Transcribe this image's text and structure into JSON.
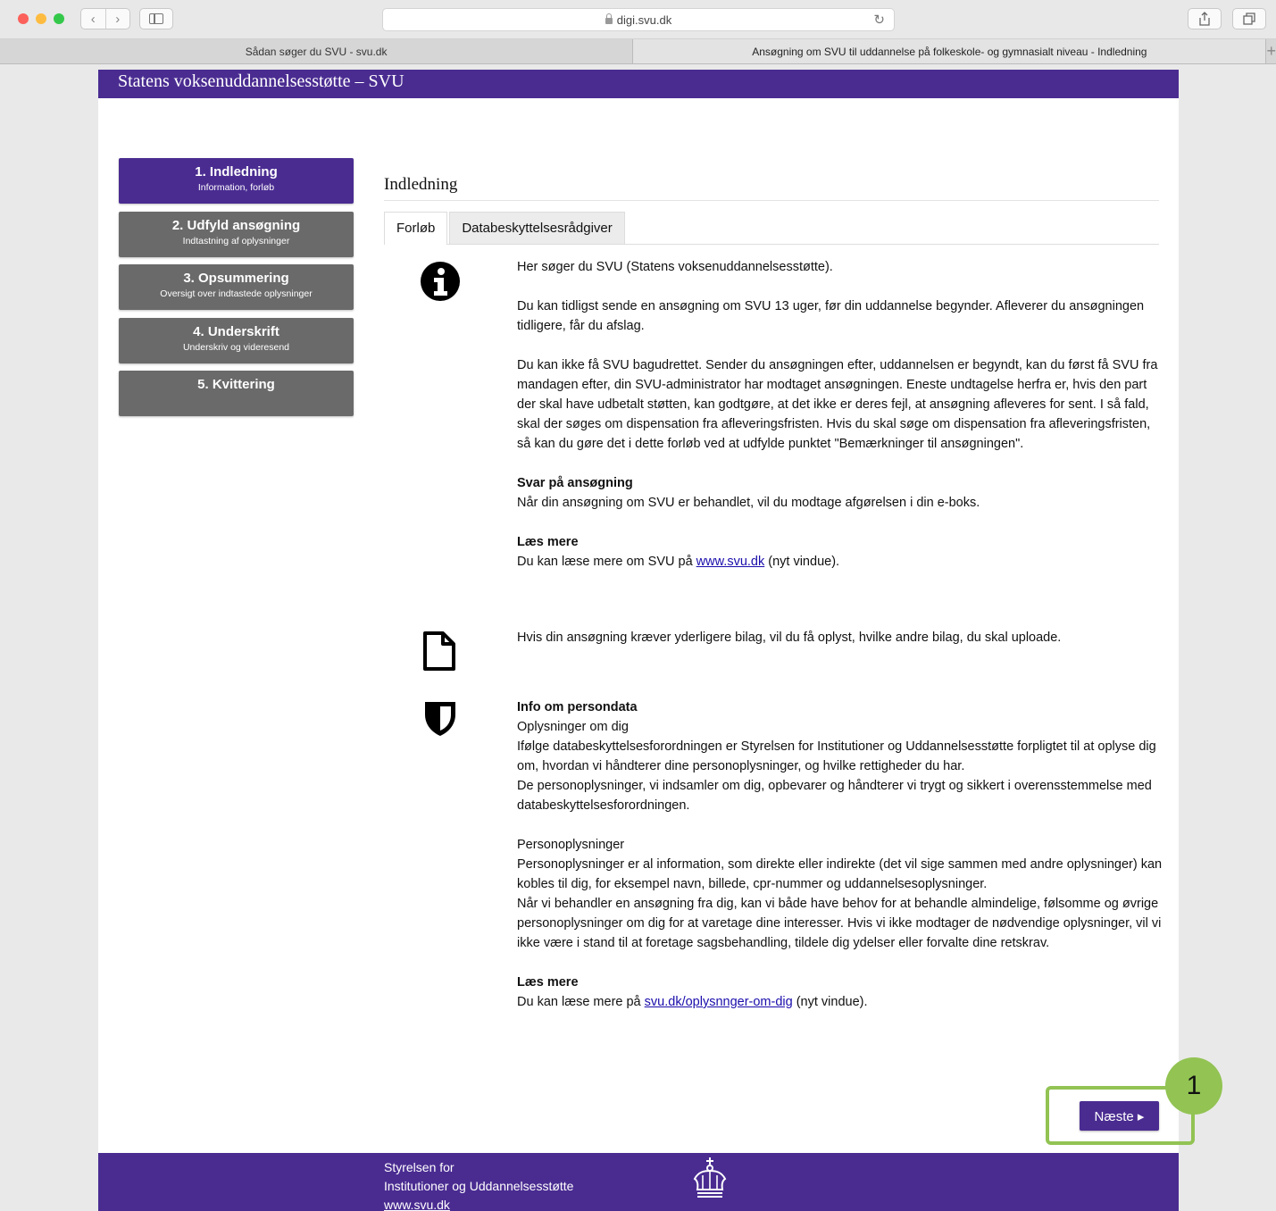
{
  "browser": {
    "url": "digi.svu.dk",
    "tabs": [
      {
        "label": "Sådan søger du SVU - svu.dk"
      },
      {
        "label": "Ansøgning om SVU til uddannelse på folkeskole- og gymnasialt niveau - Indledning"
      }
    ],
    "back_icon": "‹",
    "forward_icon": "›",
    "reload_icon": "↻",
    "new_tab_icon": "+"
  },
  "site": {
    "title": "Statens voksenuddannelsesstøtte – SVU"
  },
  "steps": [
    {
      "title": "1. Indledning",
      "subtitle": "Information, forløb"
    },
    {
      "title": "2. Udfyld ansøgning",
      "subtitle": "Indtastning af oplysninger"
    },
    {
      "title": "3. Opsummering",
      "subtitle": "Oversigt over indtastede oplysninger"
    },
    {
      "title": "4. Underskrift",
      "subtitle": "Underskriv og videresend"
    },
    {
      "title": "5. Kvittering",
      "subtitle": ""
    }
  ],
  "content": {
    "title": "Indledning",
    "tabs": [
      {
        "label": "Forløb"
      },
      {
        "label": "Databeskyttelsesrådgiver"
      }
    ],
    "info": {
      "p1": "Her søger du SVU (Statens voksenuddannelsesstøtte).",
      "p2": "Du kan tidligst sende en ansøgning om SVU 13 uger, før din uddannelse begynder. Afleverer du ansøgningen tidligere, får du afslag.",
      "p3": "Du kan ikke få SVU bagudrettet. Sender du ansøgningen efter, uddannelsen er begyndt, kan du først få SVU fra mandagen efter, din SVU-administrator har modtaget ansøgningen. Eneste undtagelse herfra er, hvis den part der skal have udbetalt støtten, kan godtgøre, at det ikke er deres fejl, at ansøgning afleveres for sent. I så fald, skal der søges om dispensation fra afleveringsfristen. Hvis du skal søge om dispensation fra afleveringsfristen, så kan du gøre det i dette forløb ved at udfylde punktet \"Bemærkninger til ansøgningen\".",
      "answer_heading": "Svar på ansøgning",
      "answer_text": "Når din ansøgning om SVU er behandlet, vil du modtage afgørelsen i din e-boks.",
      "read_more_heading": "Læs mere",
      "read_more_prefix": "Du kan læse mere om SVU på",
      "read_more_link": "www.svu.dk",
      "read_more_suffix": "(nyt vindue)."
    },
    "file": {
      "text": "Hvis din ansøgning kræver yderligere bilag, vil du få oplyst, hvilke andre bilag, du skal uploade."
    },
    "privacy": {
      "heading": "Info om persondata",
      "subheading": "Oplysninger om dig",
      "p1": "Ifølge databeskyttelsesforordningen er Styrelsen for Institutioner og Uddannelsesstøtte forpligtet til at oplyse dig om, hvordan vi håndterer dine personoplysninger, og hvilke rettigheder du har.",
      "p2": "De personoplysninger, vi indsamler om dig, opbevarer og håndterer vi trygt og sikkert i overensstemmelse med databeskyttelsesforordningen.",
      "sub2": "Personoplysninger",
      "p3": "Personoplysninger er al information, som direkte eller indirekte (det vil sige sammen med andre oplysninger) kan kobles til dig, for eksempel navn, billede, cpr-nummer og uddannelsesoplysninger.",
      "p4": "Når vi behandler en ansøgning fra dig, kan vi både have behov for at behandle almindelige, følsomme og øvrige personoplysninger om dig for at varetage dine interesser. Hvis vi ikke modtager de nødvendige oplysninger, vil vi ikke være i stand til at foretage sagsbehandling, tildele dig ydelser eller forvalte dine retskrav.",
      "read_more_heading": "Læs mere",
      "read_more_prefix": "Du kan læse mere på",
      "read_more_link": "svu.dk/oplysnnger-om-dig",
      "read_more_suffix": "(nyt vindue)."
    }
  },
  "next_button": {
    "label": "Næste ▸"
  },
  "annotation": {
    "number": "1",
    "color": "#92c353"
  },
  "footer": {
    "line1": "Styrelsen for",
    "line2": "Institutioner og Uddannelsesstøtte",
    "link": "www.svu.dk"
  },
  "colors": {
    "brand": "#4a2c91",
    "step_inactive": "#6a6a6a",
    "link": "#1a0dab"
  }
}
